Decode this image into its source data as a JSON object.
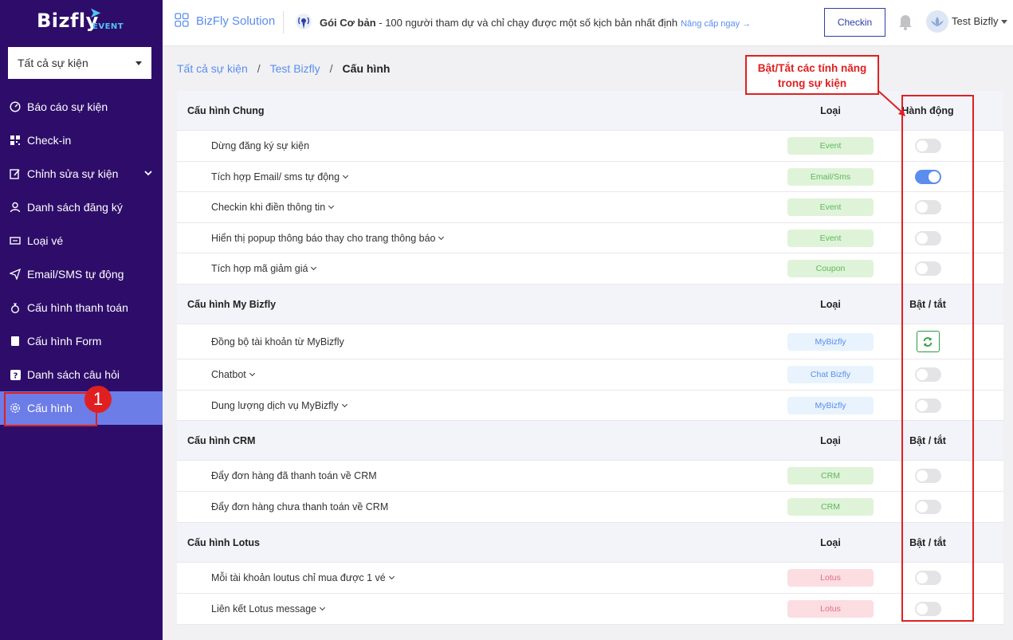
{
  "brand": {
    "logo_text": "Bizfly",
    "logo_sub": "EVENT"
  },
  "sidebar": {
    "event_select": "Tất cả sự kiện",
    "items": [
      {
        "label": "Báo cáo sự kiện",
        "icon": "gauge-icon"
      },
      {
        "label": "Check-in",
        "icon": "qr-icon"
      },
      {
        "label": "Chỉnh sửa sự kiện",
        "icon": "edit-icon"
      },
      {
        "label": "Danh sách đăng ký",
        "icon": "user-icon"
      },
      {
        "label": "Loại vé",
        "icon": "ticket-icon"
      },
      {
        "label": "Email/SMS tự động",
        "icon": "send-icon"
      },
      {
        "label": "Cấu hình thanh toán",
        "icon": "money-bag-icon"
      },
      {
        "label": "Cấu hình Form",
        "icon": "form-icon"
      },
      {
        "label": "Danh sách câu hỏi",
        "icon": "question-icon"
      },
      {
        "label": "Cấu hình",
        "icon": "gear-icon"
      }
    ],
    "step_badge": "1"
  },
  "topbar": {
    "solution": "BizFly Solution",
    "package_name": "Gói Cơ bản",
    "package_desc": " - 100 người tham dự và chỉ chạy được một số kịch bản nhất định",
    "upgrade": "Nâng cấp ngay →",
    "checkin_label": "Checkin",
    "user": "Test Bizfly"
  },
  "breadcrumb": {
    "items": [
      "Tất cả sự kiện",
      "Test Bizfly"
    ],
    "current": "Cấu hình",
    "sep": "/"
  },
  "callout": "Bật/Tắt các tính năng trong sự kiện",
  "sections": [
    {
      "title": "Cấu hình Chung",
      "type_header": "Loại",
      "action_header": "Hành động",
      "rows": [
        {
          "name": "Dừng đăng ký sự kiện",
          "type": "Event",
          "color": "green",
          "toggle": false
        },
        {
          "name": "Tích hợp Email/ sms tự động",
          "type": "Email/Sms",
          "color": "green",
          "toggle": true,
          "chevron": true
        },
        {
          "name": "Checkin khi điền thông tin",
          "type": "Event",
          "color": "green",
          "toggle": false,
          "chevron": true
        },
        {
          "name": "Hiển thị popup thông báo thay cho trang thông báo",
          "type": "Event",
          "color": "green",
          "toggle": false,
          "chevron": true
        },
        {
          "name": "Tích hợp mã giảm giá",
          "type": "Coupon",
          "color": "green",
          "toggle": false,
          "chevron": true
        }
      ]
    },
    {
      "title": "Cấu hình My Bizfly",
      "type_header": "Loại",
      "action_header": "Bật / tắt",
      "rows": [
        {
          "name": "Đồng bộ tài khoản từ MyBizfly",
          "type": "MyBizfly",
          "color": "blue",
          "sync": true
        },
        {
          "name": "Chatbot",
          "type": "Chat Bizfly",
          "color": "blue",
          "toggle": false,
          "chevron": true
        },
        {
          "name": "Dung lượng dịch vụ MyBizfly",
          "type": "MyBizfly",
          "color": "blue",
          "toggle": false,
          "chevron": true
        }
      ]
    },
    {
      "title": "Cấu hình CRM",
      "type_header": "Loại",
      "action_header": "Bật / tắt",
      "rows": [
        {
          "name": "Đẩy đơn hàng đã thanh toán về CRM",
          "type": "CRM",
          "color": "green",
          "toggle": false
        },
        {
          "name": "Đẩy đơn hàng chưa thanh toán về CRM",
          "type": "CRM",
          "color": "green",
          "toggle": false
        }
      ]
    },
    {
      "title": "Cấu hình Lotus",
      "type_header": "Loại",
      "action_header": "Bật / tắt",
      "rows": [
        {
          "name": "Mỗi tài khoản loutus chỉ mua được 1 vé",
          "type": "Lotus",
          "color": "red",
          "toggle": false,
          "chevron": true
        },
        {
          "name": "Liên kết Lotus message",
          "type": "Lotus",
          "color": "red",
          "toggle": false,
          "chevron": true
        }
      ]
    }
  ],
  "colors": {
    "sidebar": "#2e0d6a",
    "active": "#6c7de8",
    "accent": "#5b8def",
    "highlight": "#e02020"
  }
}
